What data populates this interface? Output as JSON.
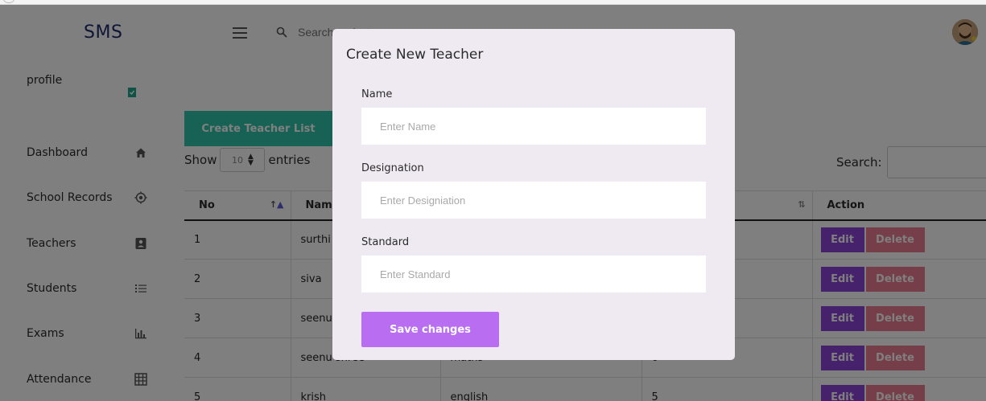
{
  "app": {
    "brand": "SMS"
  },
  "sidebar": {
    "profile_label": "profile",
    "items": [
      {
        "label": "Dashboard",
        "icon": "home-icon"
      },
      {
        "label": "School Records",
        "icon": "target-icon"
      },
      {
        "label": "Teachers",
        "icon": "contact-card-icon"
      },
      {
        "label": "Students",
        "icon": "list-icon"
      },
      {
        "label": "Exams",
        "icon": "bar-chart-icon"
      },
      {
        "label": "Attendance",
        "icon": "table-grid-icon"
      }
    ]
  },
  "header": {
    "search_placeholder": "Search projects"
  },
  "main": {
    "create_list_label": "Create Teacher List",
    "show_label": "Show",
    "entries_value": "10",
    "entries_label": "entries",
    "search_label": "Search:"
  },
  "table": {
    "columns": [
      "No",
      "Name",
      "",
      "",
      "Action"
    ],
    "rows": [
      {
        "no": "1",
        "name": "surthi",
        "designation": "",
        "standard": ""
      },
      {
        "no": "2",
        "name": "siva",
        "designation": "",
        "standard": ""
      },
      {
        "no": "3",
        "name": "seenu",
        "designation": "",
        "standard": ""
      },
      {
        "no": "4",
        "name": "seenu shree",
        "designation": "maths",
        "standard": "6"
      },
      {
        "no": "5",
        "name": "krish",
        "designation": "english",
        "standard": "5"
      }
    ],
    "edit_label": "Edit",
    "delete_label": "Delete"
  },
  "modal": {
    "title": "Create New Teacher",
    "name_label": "Name",
    "name_placeholder": "Enter Name",
    "designation_label": "Designation",
    "designation_placeholder": "Enter Designiation",
    "standard_label": "Standard",
    "standard_placeholder": "Enter Standard",
    "save_label": "Save changes"
  },
  "colors": {
    "create_list_bg": "#2fc5a8",
    "edit_bg": "#8e44d9",
    "delete_bg": "#ea7d92",
    "save_bg": "#b96ef2",
    "modal_bg": "#efeaf1"
  }
}
